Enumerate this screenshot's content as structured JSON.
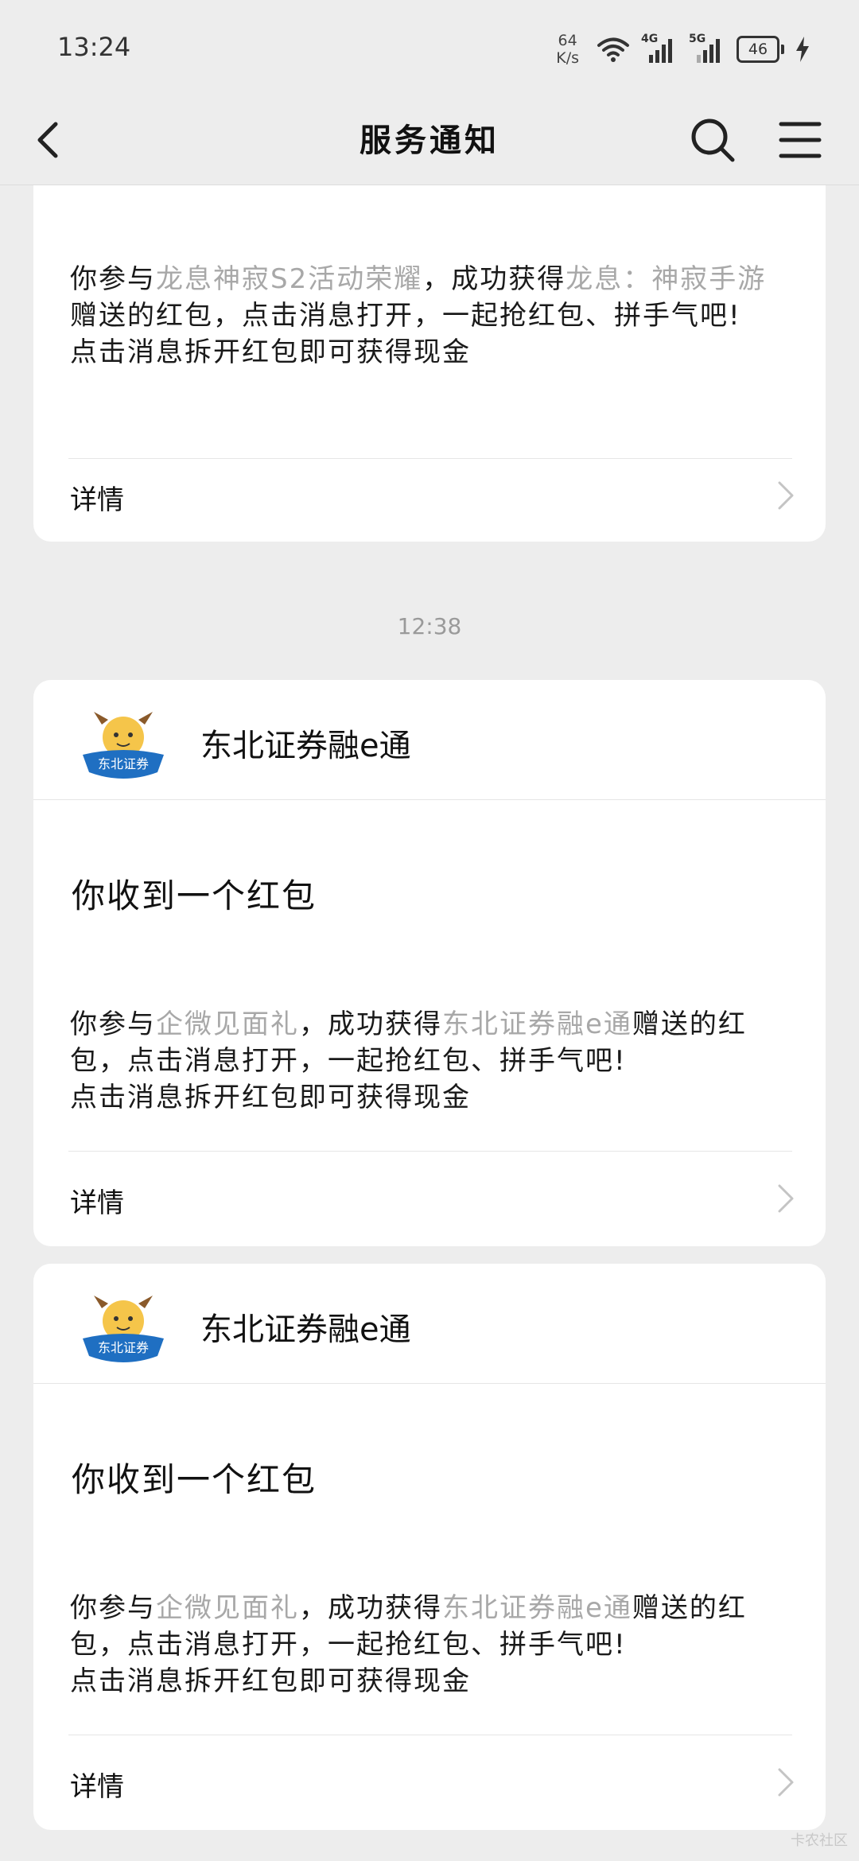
{
  "status_bar": {
    "time": "13:24",
    "net_speed_value": "64",
    "net_speed_unit": "K/s",
    "signal1_label": "4G",
    "signal2_label": "5G",
    "battery": "46"
  },
  "nav": {
    "title": "服务通知"
  },
  "cards": [
    {
      "body_parts": {
        "p1": "你参与",
        "hl1": "龙息神寂S2活动荣耀",
        "p2": "，成功获得",
        "hl2": "龙息：神寂手游",
        "p3": "赠送的红包，点击消息打开，一起抢红包、拼手气吧!",
        "line2": "点击消息拆开红包即可获得现金"
      },
      "detail_label": "详情"
    },
    {
      "sender": "东北证券融e通",
      "logo_text": "东北证券",
      "title": "你收到一个红包",
      "body_parts": {
        "p1": "你参与",
        "hl1": "企微见面礼",
        "p2": "，成功获得",
        "hl2": "东北证券融e通",
        "p3": "赠送的红包，点击消息打开，一起抢红包、拼手气吧!",
        "line2": "点击消息拆开红包即可获得现金"
      },
      "detail_label": "详情"
    },
    {
      "sender": "东北证券融e通",
      "logo_text": "东北证券",
      "title": "你收到一个红包",
      "body_parts": {
        "p1": "你参与",
        "hl1": "企微见面礼",
        "p2": "，成功获得",
        "hl2": "东北证券融e通",
        "p3": "赠送的红包，点击消息打开，一起抢红包、拼手气吧!",
        "line2": "点击消息拆开红包即可获得现金"
      },
      "detail_label": "详情"
    }
  ],
  "time_separator": "12:38",
  "watermark": "卡农社区",
  "colors": {
    "background": "#ededed",
    "card": "#ffffff",
    "highlight_text": "#a8a8a8",
    "logo_blue": "#1f6fc2",
    "logo_yellow": "#f5c54a"
  }
}
